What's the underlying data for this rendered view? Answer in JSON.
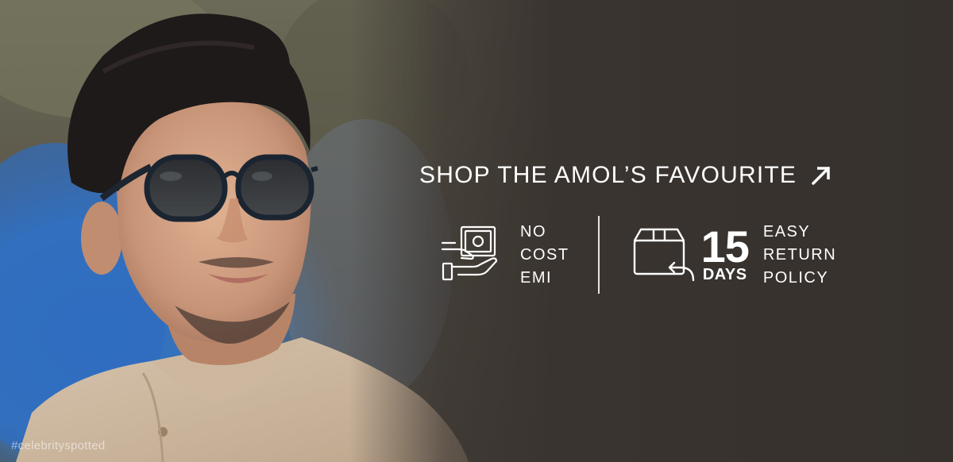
{
  "hashtag": "#celebrityspotted",
  "cta": {
    "label": "SHOP THE AMOL’S FAVOURITE",
    "icon": "arrow-up-right-icon"
  },
  "features": {
    "emi": {
      "icon": "cash-hand-icon",
      "lines": [
        "NO",
        "COST",
        "EMI"
      ]
    },
    "returns": {
      "icon": "return-box-icon",
      "days_number": "15",
      "days_label": "DAYS",
      "lines": [
        "EASY",
        "RETURN",
        "POLICY"
      ]
    }
  },
  "colors": {
    "panel_bg": "#3a3430",
    "text": "#ffffff",
    "divider": "#e8e4df"
  }
}
